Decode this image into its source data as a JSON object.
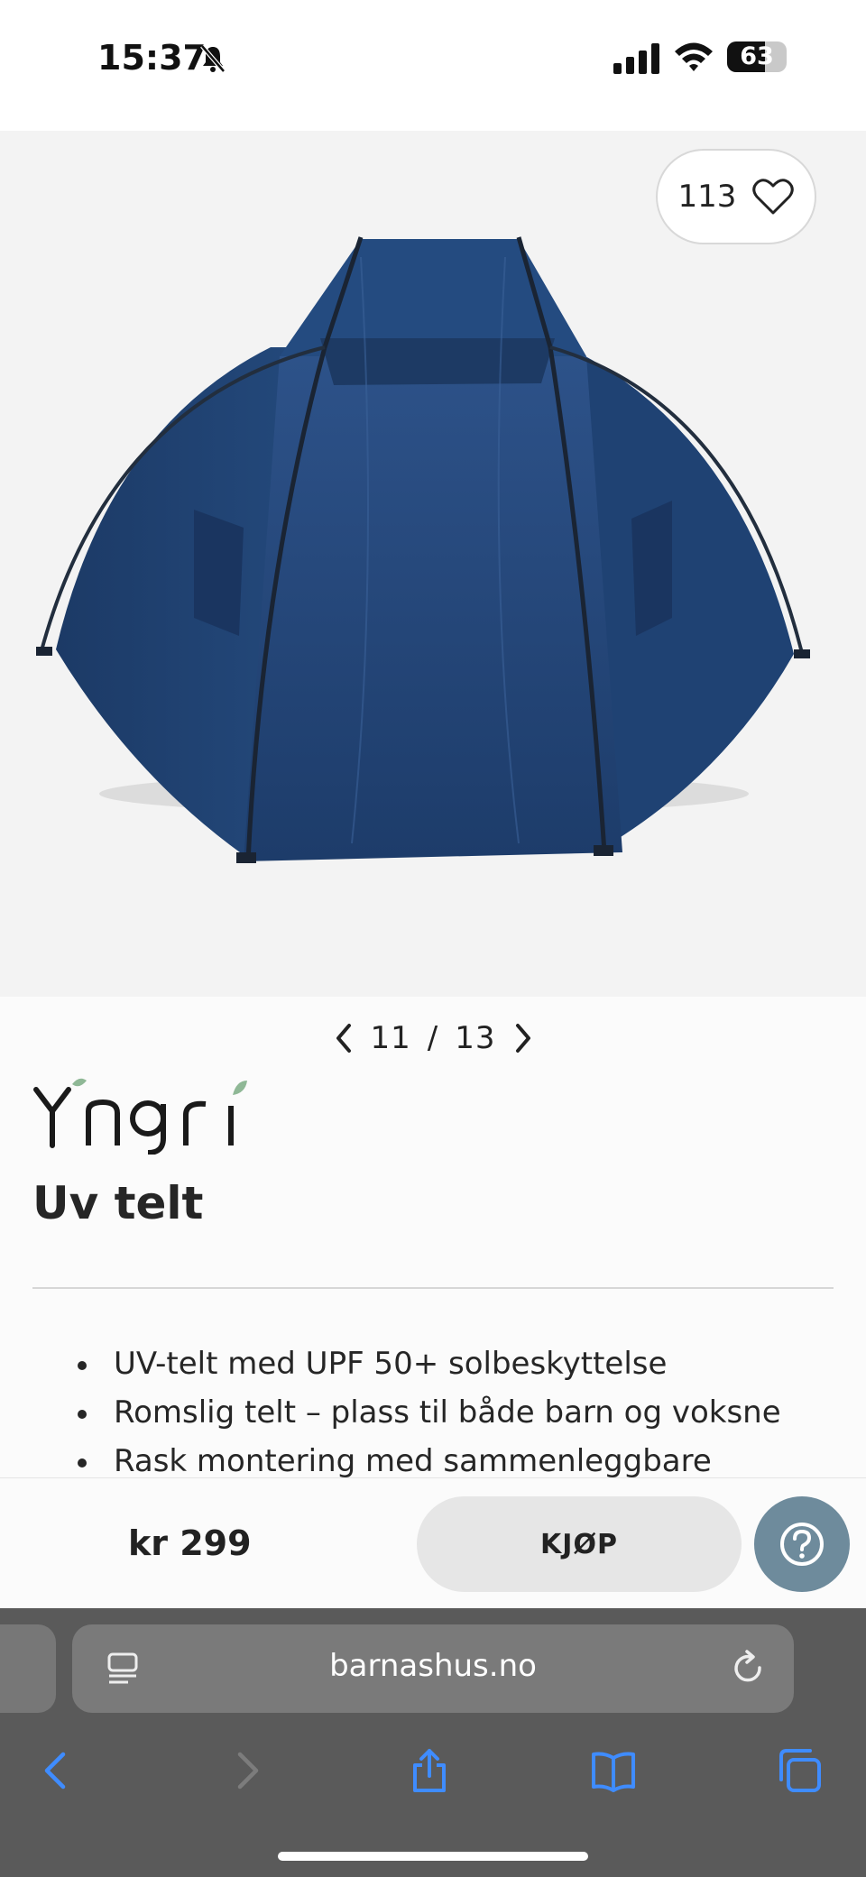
{
  "status_bar": {
    "time": "15:37",
    "battery_level": "63",
    "battery_fraction": 0.63,
    "icons": [
      "bell-slash-icon",
      "cellular-signal-icon",
      "wifi-icon",
      "battery-icon"
    ]
  },
  "product": {
    "favorites_count": "113",
    "image_pager": {
      "current": "11",
      "separator": "/",
      "total": "13"
    },
    "brand": "Yngri",
    "title": "Uv telt",
    "features": [
      "UV-telt med UPF 50+ solbeskyttelse",
      "Romslig telt – plass til både barn og voksne",
      "Rask montering med sammenleggbare"
    ],
    "tent_color": "#1f3f6e"
  },
  "buy_bar": {
    "price": "kr 299",
    "buy_label": "KJØP",
    "help_icon": "question-circle-icon",
    "help_color": "#6e8b9c"
  },
  "browser": {
    "url": "barnashus.no",
    "toolbar_icons": [
      "back-icon",
      "forward-icon",
      "share-icon",
      "bookmarks-icon",
      "tabs-icon"
    ],
    "accent": "#3f8cff"
  }
}
